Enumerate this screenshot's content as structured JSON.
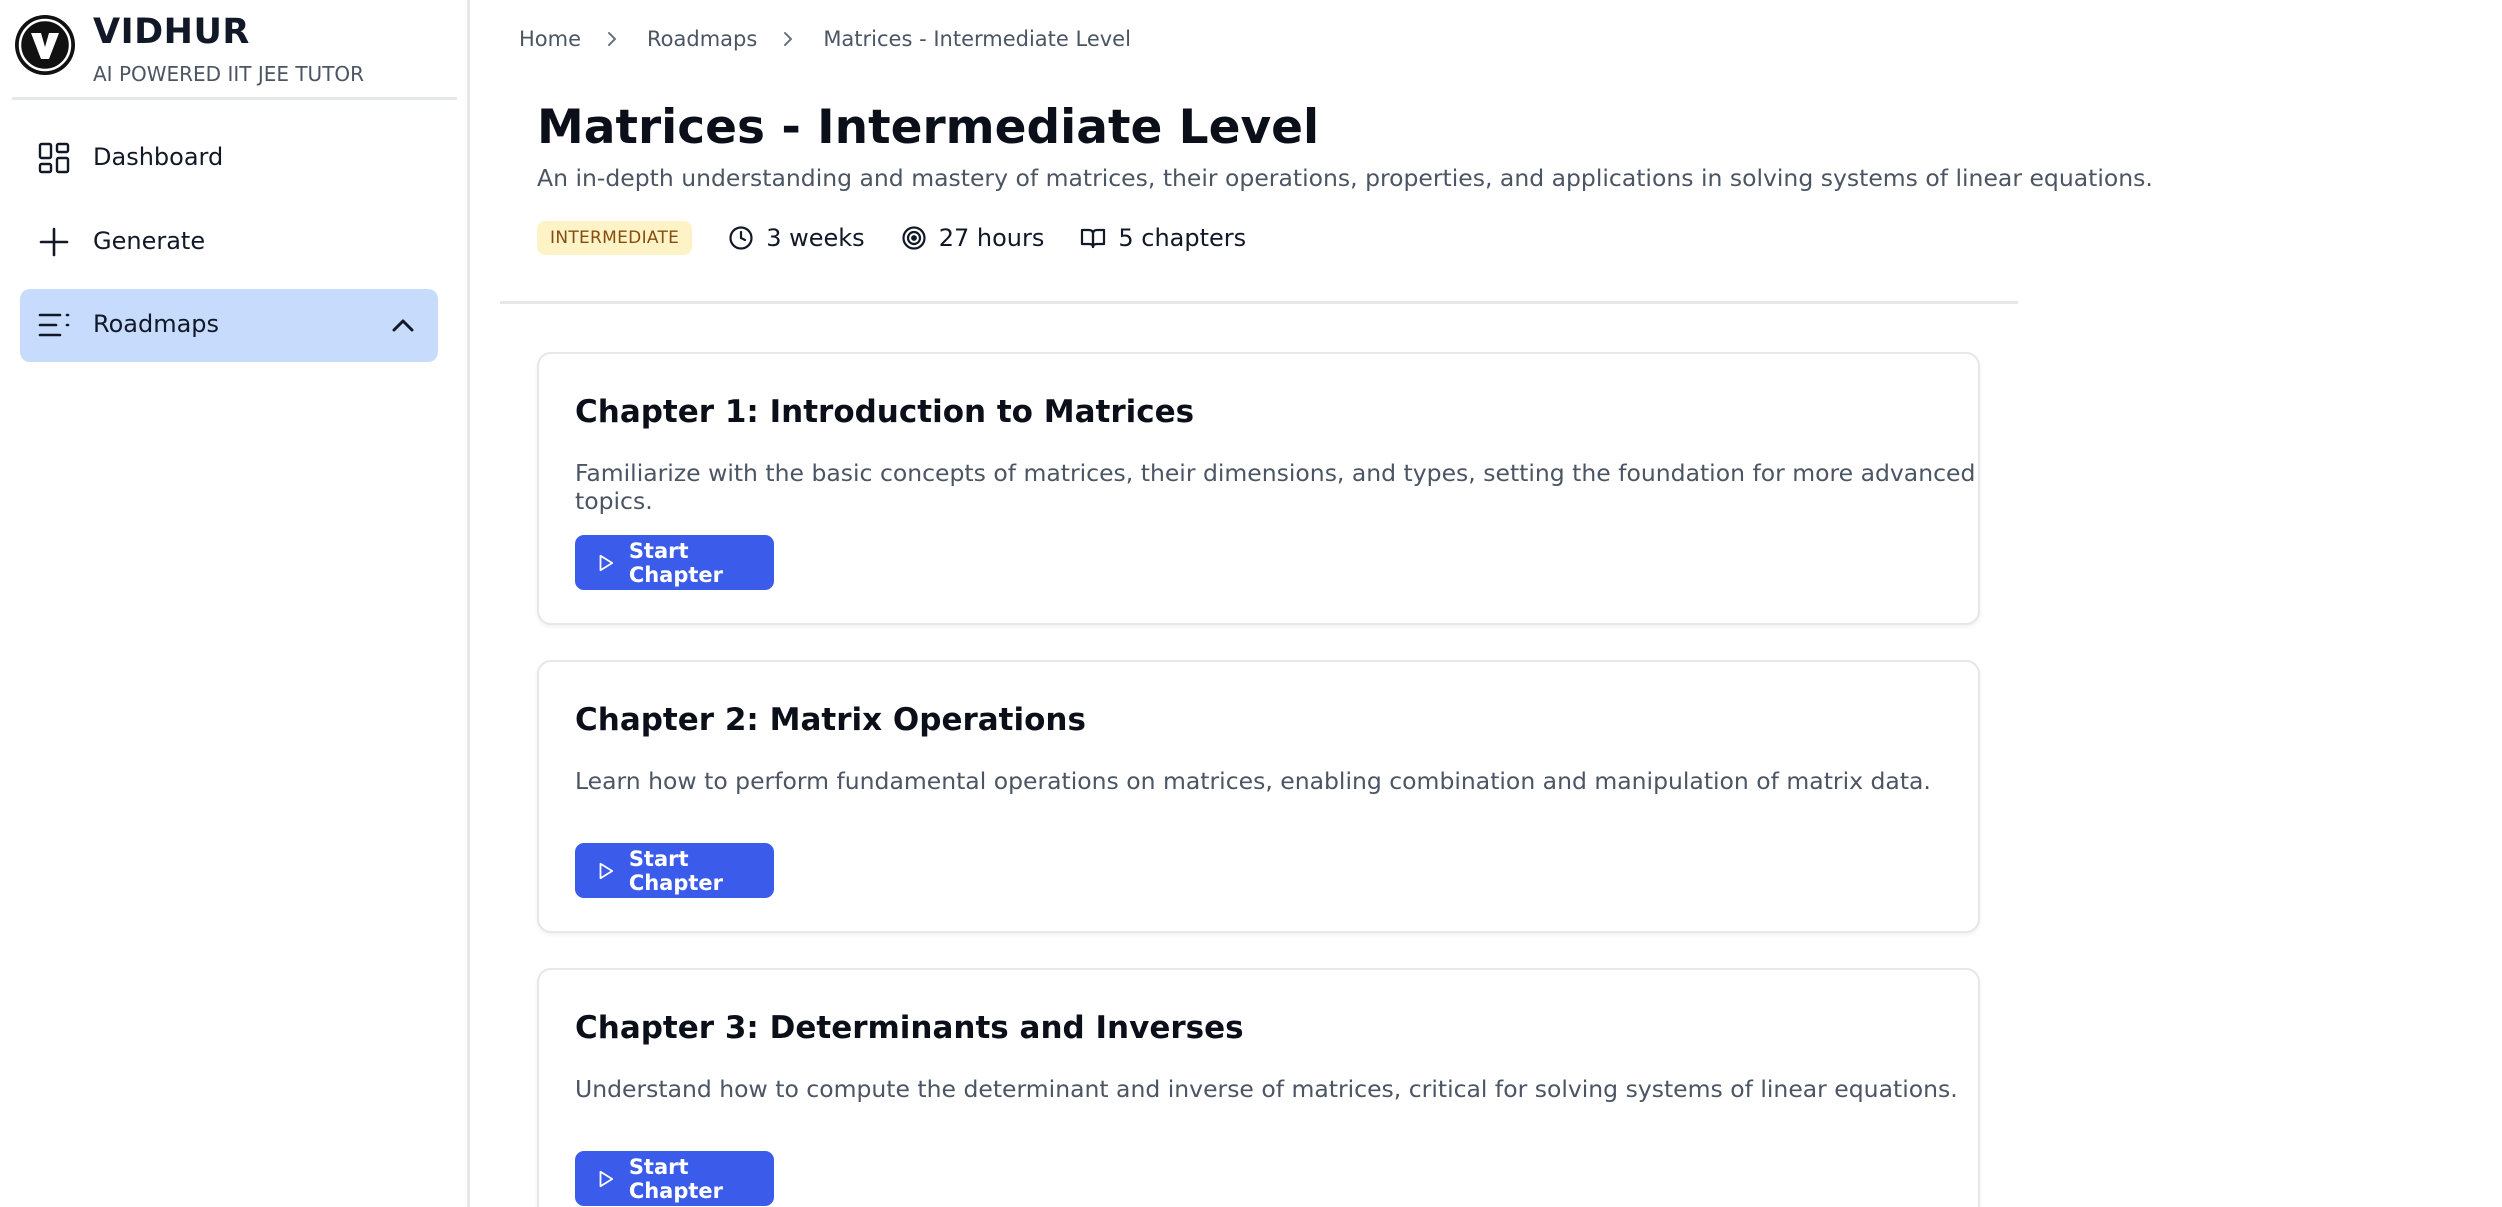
{
  "brand": {
    "name": "VIDHUR",
    "tagline": "AI POWERED IIT JEE TUTOR",
    "logo_letter": "V"
  },
  "sidebar": {
    "items": [
      {
        "label": "Dashboard",
        "icon": "dashboard-grid-icon"
      },
      {
        "label": "Generate",
        "icon": "plus-icon"
      },
      {
        "label": "Roadmaps",
        "icon": "list-icon",
        "active": true,
        "expanded": true
      }
    ]
  },
  "breadcrumb": {
    "items": [
      "Home",
      "Roadmaps",
      "Matrices - Intermediate Level"
    ]
  },
  "roadmap": {
    "title": "Matrices - Intermediate Level",
    "description": "An in-depth understanding and mastery of matrices, their operations, properties, and applications in solving systems of linear equations.",
    "level": "INTERMEDIATE",
    "duration": "3 weeks",
    "hours": "27 hours",
    "chapters_count": "5 chapters"
  },
  "chapters": [
    {
      "title": "Chapter 1: Introduction to Matrices",
      "description": "Familiarize with the basic concepts of matrices, their dimensions, and types, setting the foundation for more advanced topics.",
      "button_label": "Start Chapter"
    },
    {
      "title": "Chapter 2: Matrix Operations",
      "description": "Learn how to perform fundamental operations on matrices, enabling combination and manipulation of matrix data.",
      "button_label": "Start Chapter"
    },
    {
      "title": "Chapter 3: Determinants and Inverses",
      "description": "Understand how to compute the determinant and inverse of matrices, critical for solving systems of linear equations.",
      "button_label": "Start Chapter"
    }
  ],
  "colors": {
    "accent": "#3b5bea",
    "active_nav": "#c7dbfc",
    "badge_bg": "#fef3c7",
    "badge_text": "#854d0e"
  }
}
